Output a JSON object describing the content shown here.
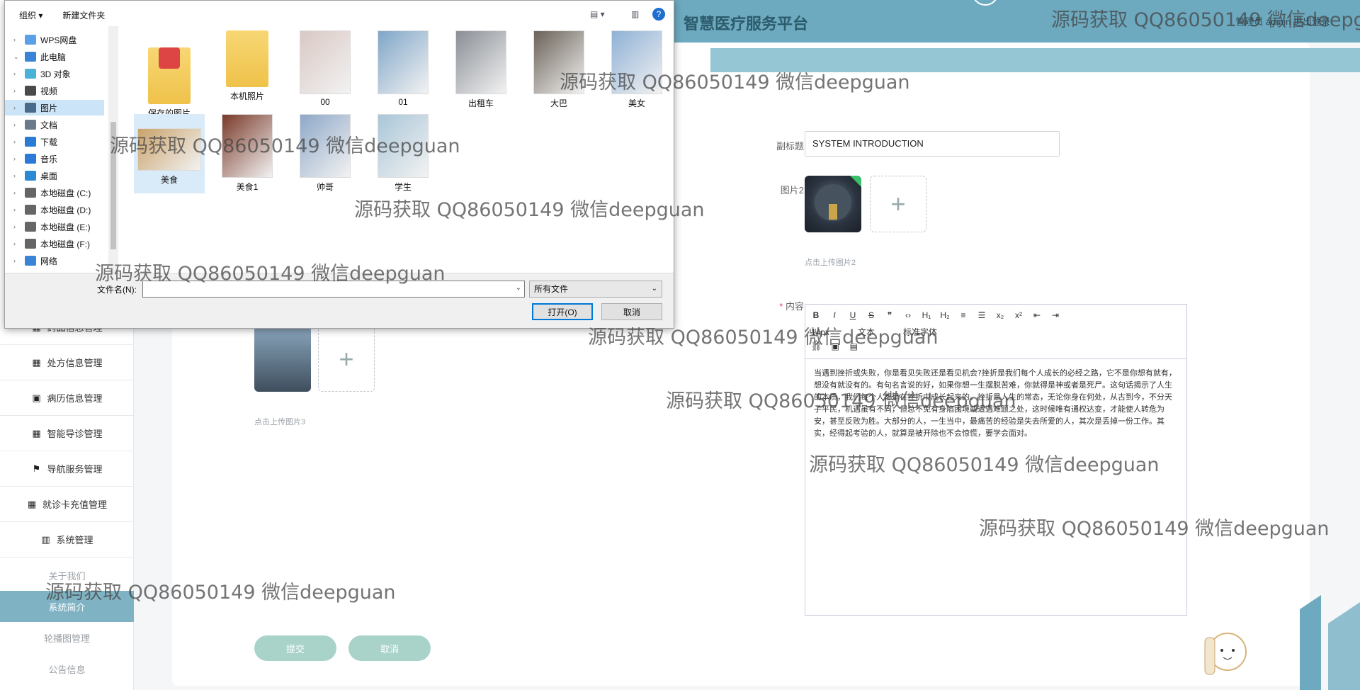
{
  "app": {
    "title": "智慧医疗服务平台",
    "user_label": "管理员 admin  退出登录"
  },
  "sidebar": {
    "items": [
      {
        "label": "药品信息管理",
        "icon": "grid-icon"
      },
      {
        "label": "处方信息管理",
        "icon": "grid-icon"
      },
      {
        "label": "病历信息管理",
        "icon": "film-icon"
      },
      {
        "label": "智能导诊管理",
        "icon": "grid-icon"
      },
      {
        "label": "导航服务管理",
        "icon": "flag-icon"
      },
      {
        "label": "就诊卡充值管理",
        "icon": "grid-icon"
      },
      {
        "label": "系统管理",
        "icon": "bar-chart-icon"
      }
    ],
    "sub_items": [
      {
        "label": "关于我们"
      },
      {
        "label": "系统简介"
      },
      {
        "label": "轮播图管理"
      },
      {
        "label": "公告信息"
      }
    ]
  },
  "form": {
    "subtitle_label": "副标题",
    "subtitle_value": "SYSTEM INTRODUCTION",
    "image2_label": "图片2",
    "image2_hint": "点击上传图片2",
    "image3_hint": "点击上传图片3",
    "content_label": "内容",
    "required_mark": "*",
    "plus": "+",
    "editor": {
      "toolbar1": [
        "B",
        "I",
        "U",
        "S",
        "❞",
        "‹›",
        "H₁",
        "H₂",
        "≡",
        "☰",
        "x₂",
        "x²",
        "⇤",
        "⇥"
      ],
      "font_size": "14px",
      "font_text": "文本",
      "font_family": "标准字体",
      "content": "当遇到挫折或失败，你是看见失败还是看见机会?挫折是我们每个人成长的必经之路，它不是你想有就有，想没有就没有的。有句名言说的好，如果你想一生摆脱苦难，你就得是神或者是死尸。这句话揭示了人生的本质，我们每个人都是在挫折中成长起来的。挫折是人生的常态，无论你身在何处，从古到今，不分天子平民，机遇虽有不同，但总不免有身陷困境或遭遇难题之处，这时候唯有通权达变，才能使人转危为安，甚至反败为胜。大部分的人，一生当中，最痛苦的经验是失去所爱的人，其次是丢掉一份工作。其实，经得起考验的人，就算是被开除也不会惊慌，要学会面对。"
    },
    "submit_label": "提交",
    "cancel_label": "取消"
  },
  "dialog": {
    "toolbar": {
      "organize": "组织 ▾",
      "new_folder": "新建文件夹"
    },
    "tree": [
      {
        "label": "WPS网盘",
        "icon": "cloud-icon",
        "chev": "›"
      },
      {
        "label": "此电脑",
        "icon": "computer-icon",
        "chev": "⌄"
      },
      {
        "label": "3D 对象",
        "icon": "cube-icon",
        "chev": "›"
      },
      {
        "label": "视频",
        "icon": "video-icon",
        "chev": "›"
      },
      {
        "label": "图片",
        "icon": "picture-icon",
        "chev": "›",
        "selected": true
      },
      {
        "label": "文档",
        "icon": "document-icon",
        "chev": "›"
      },
      {
        "label": "下载",
        "icon": "download-icon",
        "chev": "›"
      },
      {
        "label": "音乐",
        "icon": "music-icon",
        "chev": "›"
      },
      {
        "label": "桌面",
        "icon": "desktop-icon",
        "chev": "›"
      },
      {
        "label": "本地磁盘 (C:)",
        "icon": "drive-icon",
        "chev": "›"
      },
      {
        "label": "本地磁盘 (D:)",
        "icon": "drive-icon",
        "chev": "›"
      },
      {
        "label": "本地磁盘 (E:)",
        "icon": "drive-icon",
        "chev": "›"
      },
      {
        "label": "本地磁盘 (F:)",
        "icon": "drive-icon",
        "chev": "›"
      },
      {
        "label": "网络",
        "icon": "network-icon",
        "chev": "›"
      }
    ],
    "files": [
      {
        "name": "保存的图片",
        "kind": "folder-special"
      },
      {
        "name": "本机照片",
        "kind": "folder"
      },
      {
        "name": "00",
        "kind": "photo",
        "color": "#d9c8c4"
      },
      {
        "name": "01",
        "kind": "photo",
        "color": "#7fa6c8"
      },
      {
        "name": "出租车",
        "kind": "photo",
        "color": "#8a8f96"
      },
      {
        "name": "大巴",
        "kind": "photo",
        "color": "#6b6258"
      },
      {
        "name": "美女",
        "kind": "photo",
        "color": "#8fb1d6"
      },
      {
        "name": "美食",
        "kind": "photo",
        "color": "#c9a26a",
        "selected": true
      },
      {
        "name": "美食1",
        "kind": "photo",
        "color": "#7a3a2a"
      },
      {
        "name": "帅哥",
        "kind": "photo",
        "color": "#8ea8c8"
      },
      {
        "name": "学生",
        "kind": "photo",
        "color": "#a9c6d8"
      }
    ],
    "filename_label": "文件名(N):",
    "filename_value": "",
    "filetype": "所有文件",
    "open_label": "打开(O)",
    "cancel_label": "取消"
  },
  "watermark": "源码获取 QQ86050149 微信deepguan",
  "colors": {
    "header": "#6da9bf",
    "active": "#7fb3c4",
    "button": "#a9d3c9"
  }
}
